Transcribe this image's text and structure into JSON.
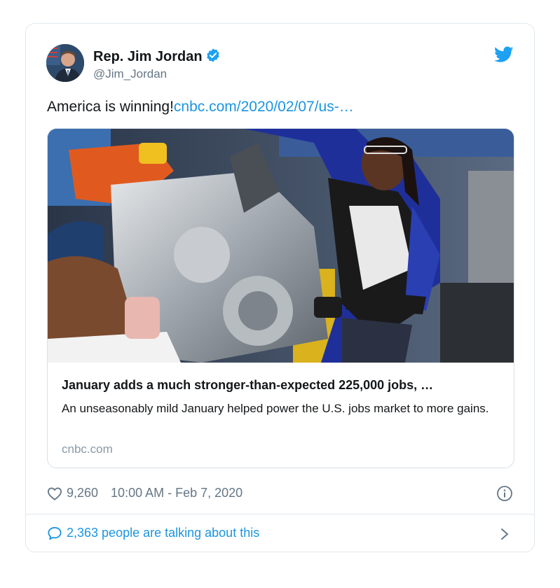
{
  "author": {
    "name": "Rep. Jim Jordan",
    "handle": "@Jim_Jordan",
    "verified_icon": "verified-badge-icon",
    "avatar_icon": "avatar"
  },
  "platform_icon": "twitter-bird-icon",
  "tweet": {
    "text": "America is winning!",
    "link": "cnbc.com/2020/02/07/us-…"
  },
  "card": {
    "image_icon": "article-photo",
    "title": "January adds a much stronger-than-expected 225,000 jobs, …",
    "description": "An unseasonably mild January helped power the U.S. jobs market to more gains.",
    "domain": "cnbc.com"
  },
  "meta": {
    "likes": "9,260",
    "timestamp": "10:00 AM - Feb 7, 2020",
    "heart_icon": "heart-icon",
    "info_icon": "info-icon"
  },
  "conversation": {
    "text": "2,363 people are talking about this",
    "bubble_icon": "comment-bubble-icon",
    "chevron_icon": "chevron-right-icon"
  },
  "colors": {
    "link": "#1b95e0",
    "secondary": "#657786",
    "border": "#e1e8ed"
  }
}
